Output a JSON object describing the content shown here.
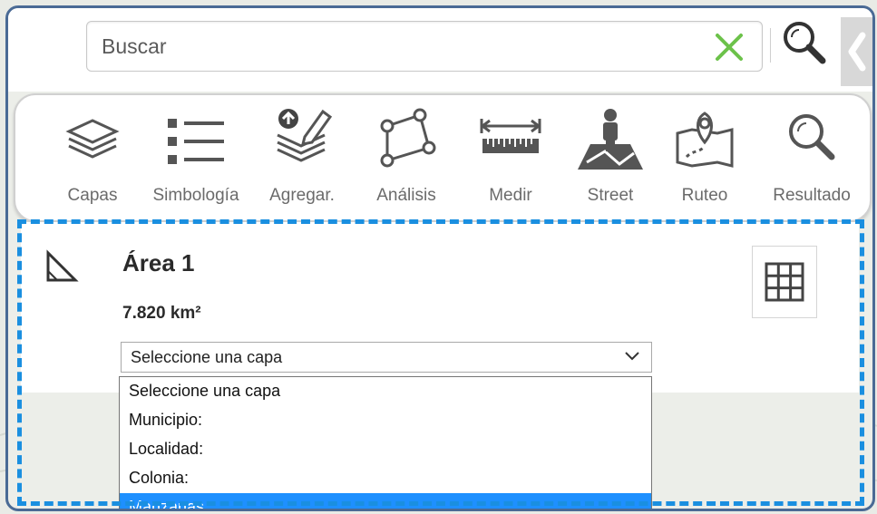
{
  "search": {
    "placeholder": "Buscar",
    "value": ""
  },
  "toolbar": {
    "items": [
      {
        "label": "Capas",
        "icon": "layers-icon"
      },
      {
        "label": "Simbología",
        "icon": "list-icon"
      },
      {
        "label": "Agregar.",
        "icon": "add-edit-icon"
      },
      {
        "label": "Análisis",
        "icon": "polygon-icon"
      },
      {
        "label": "Medir",
        "icon": "ruler-icon"
      },
      {
        "label": "Street",
        "icon": "street-view-icon"
      },
      {
        "label": "Ruteo",
        "icon": "route-map-icon"
      },
      {
        "label": "Resultado",
        "icon": "search-icon"
      }
    ]
  },
  "measure": {
    "title": "Área 1",
    "value": "7.820 km²",
    "select_label": "Seleccione una capa",
    "options": [
      {
        "label": "Seleccione una capa",
        "selected": false
      },
      {
        "label": "Municipio:",
        "selected": false
      },
      {
        "label": "Localidad:",
        "selected": false
      },
      {
        "label": "Colonia:",
        "selected": false
      },
      {
        "label": "Manzanas",
        "selected": true
      }
    ]
  },
  "colors": {
    "accent_dash": "#1a8fe0",
    "clear_icon": "#6cc24a",
    "frame": "#4a6a95",
    "selected_option": "#1e90ff"
  }
}
